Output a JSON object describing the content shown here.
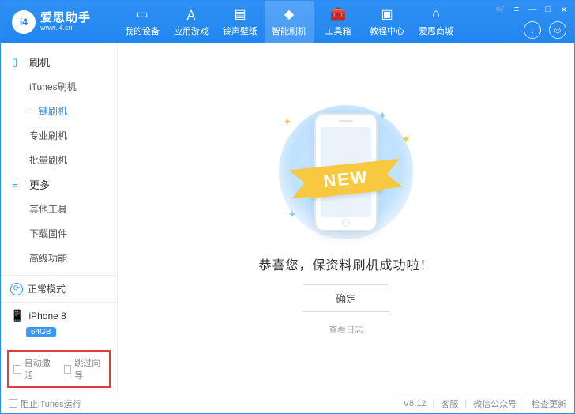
{
  "logo": {
    "badge": "i4",
    "title": "爱思助手",
    "sub": "www.i4.cn"
  },
  "nav": {
    "items": [
      {
        "label": "我的设备"
      },
      {
        "label": "应用游戏"
      },
      {
        "label": "铃声壁纸"
      },
      {
        "label": "智能刷机"
      },
      {
        "label": "工具箱"
      },
      {
        "label": "教程中心"
      },
      {
        "label": "爱思商城"
      }
    ]
  },
  "sidebar": {
    "group1": {
      "title": "刷机",
      "items": [
        "iTunes刷机",
        "一键刷机",
        "专业刷机",
        "批量刷机"
      ]
    },
    "group2": {
      "title": "更多",
      "items": [
        "其他工具",
        "下载固件",
        "高级功能"
      ]
    },
    "status": "正常模式",
    "device": {
      "name": "iPhone 8",
      "storage": "64GB"
    },
    "opt1": "自动激活",
    "opt2": "跳过向导"
  },
  "main": {
    "ribbon": "NEW",
    "message": "恭喜您，保资料刷机成功啦！",
    "ok": "确定",
    "log": "查看日志"
  },
  "footer": {
    "block_itunes": "阻止iTunes运行",
    "version": "V8.12",
    "svc": "客服",
    "wechat": "微信公众号",
    "update": "检查更新"
  }
}
